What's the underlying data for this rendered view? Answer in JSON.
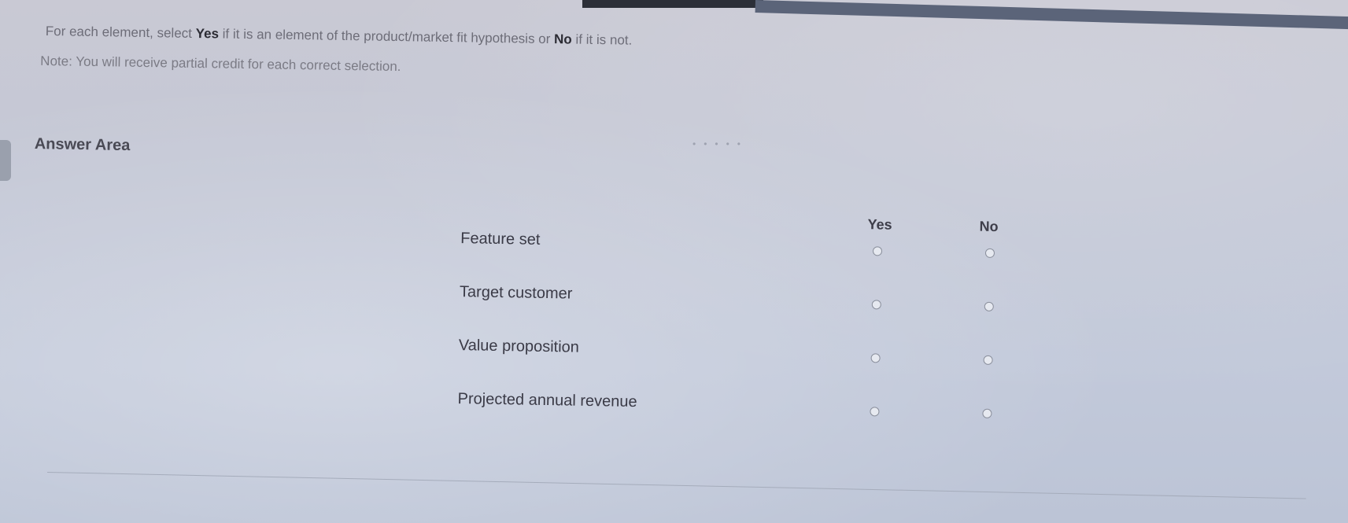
{
  "instructions": {
    "line1_part1": "For each element, select ",
    "line1_yes": "Yes",
    "line1_part2": " if it is an element of the product/market fit hypothesis or ",
    "line1_no": "No",
    "line1_part3": " if it is not.",
    "note": "Note: You will receive partial credit for each correct selection."
  },
  "answer_area": {
    "title": "Answer Area",
    "columns": {
      "yes": "Yes",
      "no": "No"
    },
    "rows": [
      {
        "label": "Feature set",
        "yes_selected": false,
        "no_selected": false
      },
      {
        "label": "Target customer",
        "yes_selected": false,
        "no_selected": false
      },
      {
        "label": "Value proposition",
        "yes_selected": false,
        "no_selected": false
      },
      {
        "label": "Projected annual revenue",
        "yes_selected": false,
        "no_selected": false
      }
    ]
  }
}
